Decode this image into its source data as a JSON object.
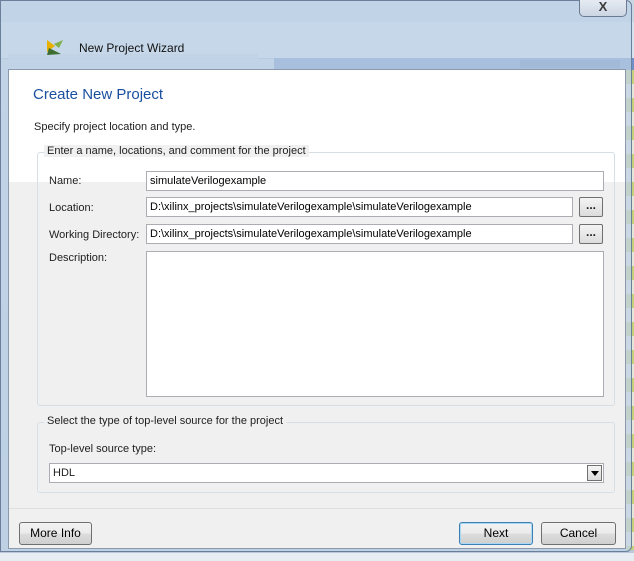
{
  "window": {
    "title": "New Project Wizard",
    "close_glyph": "X"
  },
  "header": {
    "title": "Create New Project",
    "subtitle": "Specify project location and type."
  },
  "project_group": {
    "title": "Enter a name, locations, and comment for the project",
    "name_label": "Name:",
    "name_value": "simulateVerilogexample",
    "location_label": "Location:",
    "location_value": "D:\\xilinx_projects\\simulateVerilogexample\\simulateVerilogexample",
    "location_browse": "...",
    "workdir_label": "Working Directory:",
    "workdir_value": "D:\\xilinx_projects\\simulateVerilogexample\\simulateVerilogexample",
    "workdir_browse": "...",
    "description_label": "Description:",
    "description_value": ""
  },
  "source_group": {
    "title": "Select the type of top-level source for the project",
    "type_label": "Top-level source type:",
    "type_value": "HDL"
  },
  "footer": {
    "more_info": "More Info",
    "next": "Next",
    "cancel": "Cancel"
  },
  "colors": {
    "title_blue": "#1a4fa0",
    "dialog_bg": "#f0f0f0",
    "default_button_border": "#3c7fb1"
  },
  "icons": {
    "app": "xilinx-wizard-icon",
    "close": "close-icon",
    "dropdown": "chevron-down-icon"
  }
}
